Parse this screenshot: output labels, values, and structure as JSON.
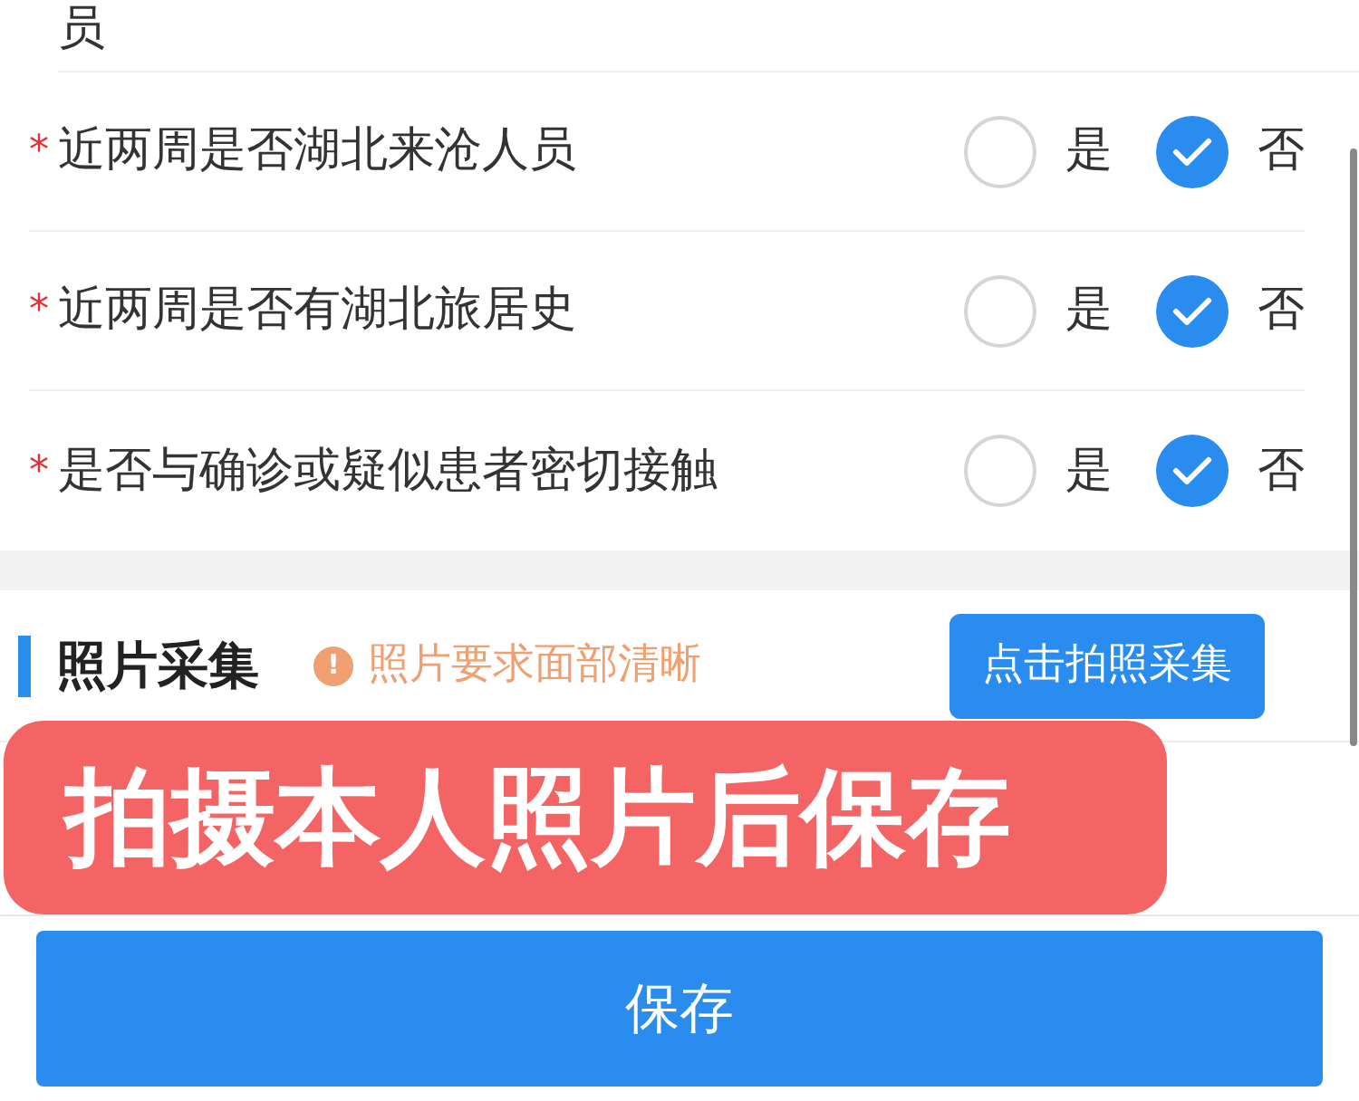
{
  "top_cut_text": "员",
  "questions": [
    {
      "required_mark": "*",
      "label": "近两周是否湖北来沧人员",
      "options": [
        {
          "label": "是",
          "selected": false
        },
        {
          "label": "否",
          "selected": true
        }
      ]
    },
    {
      "required_mark": "*",
      "label": "近两周是否有湖北旅居史",
      "options": [
        {
          "label": "是",
          "selected": false
        },
        {
          "label": "否",
          "selected": true
        }
      ]
    },
    {
      "required_mark": "*",
      "label": "是否与确诊或疑似患者密切接触",
      "options": [
        {
          "label": "是",
          "selected": false
        },
        {
          "label": "否",
          "selected": true
        }
      ]
    }
  ],
  "photo_section": {
    "title": "照片采集",
    "hint_icon": "!",
    "hint": "照片要求面部清晰",
    "capture_button": "点击拍照采集"
  },
  "callout": "拍摄本人照片后保存",
  "save_button": "保存"
}
